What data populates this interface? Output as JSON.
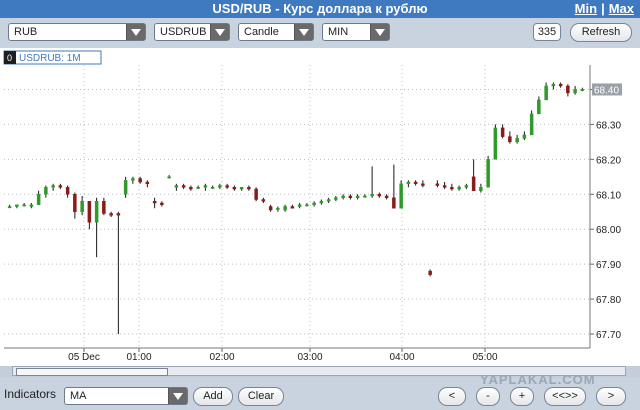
{
  "header": {
    "title": "USD/RUB - Курс доллара к рублю",
    "min_label": "Min",
    "sep": "|",
    "max_label": "Max"
  },
  "toolbar": {
    "currency": "RUB",
    "symbol": "USDRUB",
    "chart_type": "Candle",
    "interval": "MIN",
    "count": "335",
    "refresh_label": "Refresh"
  },
  "chart_tab": {
    "index": "0",
    "label": "USDRUB: 1M"
  },
  "bottom": {
    "indicators_label": "Indicators",
    "indicator_value": "MA",
    "add_label": "Add",
    "clear_label": "Clear",
    "nav": [
      "<",
      "-",
      "+",
      "<<>>",
      ">"
    ],
    "watermark": "YAPLAKAL.COM"
  },
  "colors": {
    "up": "#2f9a2a",
    "down": "#8b1a1a",
    "header": "#3f7ac0",
    "last_price_bg": "#9aa0a8"
  },
  "chart_data": {
    "type": "candlestick",
    "title": "USDRUB: 1M",
    "ylim": [
      67.66,
      68.47
    ],
    "yticks": [
      "68.40",
      "68.30",
      "68.20",
      "68.10",
      "68.00",
      "67.90",
      "67.80",
      "67.70"
    ],
    "xticks": [
      "05 Dec",
      "01:00",
      "02:00",
      "03:00",
      "04:00",
      "05:00"
    ],
    "last_price": "68.40",
    "grid": true,
    "candles": [
      [
        68.065,
        68.07,
        68.06,
        68.065
      ],
      [
        68.065,
        68.07,
        68.06,
        68.07
      ],
      [
        68.07,
        68.075,
        68.065,
        68.07
      ],
      [
        68.065,
        68.075,
        68.06,
        68.07
      ],
      [
        68.07,
        68.11,
        68.07,
        68.1
      ],
      [
        68.1,
        68.125,
        68.09,
        68.12
      ],
      [
        68.12,
        68.13,
        68.11,
        68.125
      ],
      [
        68.125,
        68.13,
        68.115,
        68.12
      ],
      [
        68.12,
        68.125,
        68.09,
        68.1
      ],
      [
        68.1,
        68.105,
        68.03,
        68.05
      ],
      [
        68.05,
        68.095,
        68.04,
        68.08
      ],
      [
        68.08,
        68.08,
        68.0,
        68.02
      ],
      [
        68.02,
        68.09,
        67.92,
        68.08
      ],
      [
        68.08,
        68.09,
        68.04,
        68.045
      ],
      [
        68.045,
        68.05,
        68.035,
        68.04
      ],
      [
        68.045,
        68.05,
        67.7,
        68.04
      ],
      [
        68.1,
        68.15,
        68.09,
        68.14
      ],
      [
        68.14,
        68.15,
        68.13,
        68.145
      ],
      [
        68.145,
        68.15,
        68.13,
        68.135
      ],
      [
        68.135,
        68.14,
        68.12,
        68.13
      ],
      [
        68.08,
        68.09,
        68.06,
        68.075
      ],
      [
        68.075,
        68.08,
        68.065,
        68.07
      ],
      [
        68.15,
        68.155,
        68.145,
        68.15
      ],
      [
        68.12,
        68.13,
        68.11,
        68.125
      ],
      [
        68.125,
        68.13,
        68.115,
        68.12
      ],
      [
        68.12,
        68.125,
        68.11,
        68.115
      ],
      [
        68.12,
        68.125,
        68.115,
        68.12
      ],
      [
        68.12,
        68.13,
        68.11,
        68.125
      ],
      [
        68.12,
        68.125,
        68.115,
        68.12
      ],
      [
        68.12,
        68.13,
        68.115,
        68.125
      ],
      [
        68.125,
        68.13,
        68.115,
        68.12
      ],
      [
        68.12,
        68.125,
        68.11,
        68.115
      ],
      [
        68.115,
        68.12,
        68.11,
        68.12
      ],
      [
        68.12,
        68.125,
        68.11,
        68.115
      ],
      [
        68.115,
        68.12,
        68.08,
        68.085
      ],
      [
        68.085,
        68.09,
        68.075,
        68.08
      ],
      [
        68.065,
        68.07,
        68.05,
        68.055
      ],
      [
        68.06,
        68.065,
        68.05,
        68.06
      ],
      [
        68.055,
        68.07,
        68.05,
        68.065
      ],
      [
        68.065,
        68.07,
        68.06,
        68.06
      ],
      [
        68.065,
        68.075,
        68.06,
        68.07
      ],
      [
        68.07,
        68.075,
        68.065,
        68.07
      ],
      [
        68.07,
        68.08,
        68.065,
        68.075
      ],
      [
        68.075,
        68.085,
        68.07,
        68.08
      ],
      [
        68.08,
        68.09,
        68.075,
        68.085
      ],
      [
        68.085,
        68.095,
        68.08,
        68.09
      ],
      [
        68.09,
        68.1,
        68.085,
        68.095
      ],
      [
        68.095,
        68.1,
        68.085,
        68.09
      ],
      [
        68.09,
        68.1,
        68.085,
        68.095
      ],
      [
        68.095,
        68.1,
        68.09,
        68.095
      ],
      [
        68.095,
        68.18,
        68.09,
        68.1
      ],
      [
        68.1,
        68.105,
        68.09,
        68.095
      ],
      [
        68.095,
        68.1,
        68.085,
        68.09
      ],
      [
        68.09,
        68.185,
        68.06,
        68.06
      ],
      [
        68.06,
        68.14,
        68.06,
        68.13
      ],
      [
        68.13,
        68.14,
        68.12,
        68.135
      ],
      [
        68.135,
        68.14,
        68.125,
        68.13
      ],
      [
        68.13,
        68.14,
        68.12,
        68.125
      ],
      [
        67.88,
        67.885,
        67.865,
        67.87
      ],
      [
        68.13,
        68.14,
        68.12,
        68.125
      ],
      [
        68.125,
        68.135,
        68.115,
        68.12
      ],
      [
        68.12,
        68.13,
        68.11,
        68.115
      ],
      [
        68.115,
        68.125,
        68.11,
        68.12
      ],
      [
        68.12,
        68.13,
        68.115,
        68.125
      ],
      [
        68.15,
        68.2,
        68.11,
        68.11
      ],
      [
        68.11,
        68.13,
        68.105,
        68.12
      ],
      [
        68.12,
        68.21,
        68.12,
        68.2
      ],
      [
        68.2,
        68.3,
        68.2,
        68.29
      ],
      [
        68.29,
        68.3,
        68.26,
        68.265
      ],
      [
        68.265,
        68.28,
        68.245,
        68.25
      ],
      [
        68.25,
        68.27,
        68.245,
        68.26
      ],
      [
        68.26,
        68.28,
        68.255,
        68.27
      ],
      [
        68.27,
        68.34,
        68.27,
        68.33
      ],
      [
        68.33,
        68.38,
        68.33,
        68.37
      ],
      [
        68.37,
        68.42,
        68.37,
        68.41
      ],
      [
        68.41,
        68.42,
        68.4,
        68.415
      ],
      [
        68.415,
        68.42,
        68.405,
        68.41
      ],
      [
        68.41,
        68.415,
        68.38,
        68.39
      ],
      [
        68.39,
        68.41,
        68.385,
        68.4
      ],
      [
        68.4,
        68.405,
        68.395,
        68.4
      ]
    ]
  }
}
